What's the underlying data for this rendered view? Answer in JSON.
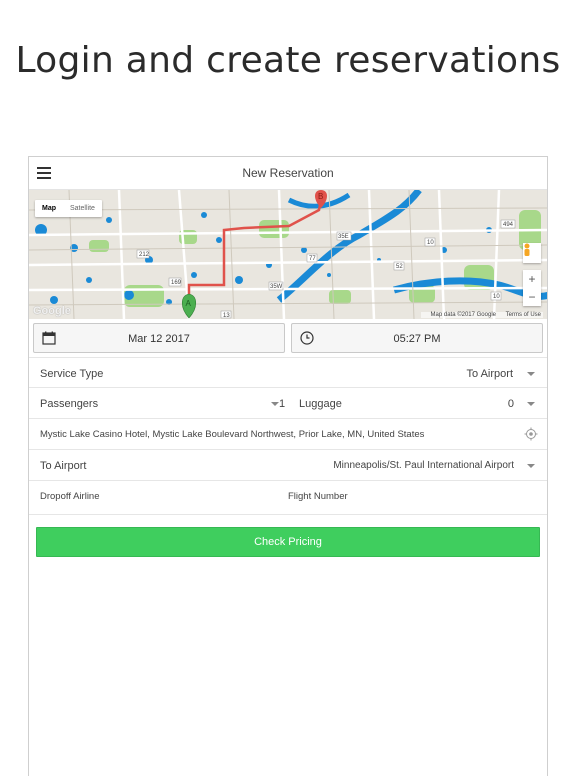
{
  "headline": "Login and create reservations",
  "navbar": {
    "title": "New Reservation"
  },
  "map": {
    "type_map": "Map",
    "type_satellite": "Satellite",
    "logo": "Google",
    "attribution": "Map data ©2017 Google",
    "terms": "Terms of Use",
    "zoom_in": "+",
    "zoom_out": "−",
    "marker_a": "A",
    "marker_b": "B",
    "road_shields": [
      "494",
      "212",
      "169",
      "35E",
      "35W",
      "77",
      "52",
      "10",
      "13",
      "10"
    ]
  },
  "datetime": {
    "date": "Mar 12 2017",
    "time": "05:27 PM"
  },
  "form": {
    "service_type_label": "Service Type",
    "service_type_value": "To Airport",
    "passengers_label": "Passengers",
    "passengers_value": "1",
    "luggage_label": "Luggage",
    "luggage_value": "0",
    "pickup_address": "Mystic Lake Casino Hotel, Mystic Lake Boulevard Northwest, Prior Lake, MN, United States",
    "to_airport_label": "To Airport",
    "to_airport_value": "Minneapolis/St. Paul International Airport",
    "dropoff_airline_placeholder": "Dropoff Airline",
    "flight_number_placeholder": "Flight Number"
  },
  "button": {
    "check_pricing": "Check Pricing"
  },
  "colors": {
    "accent_green": "#3fce5e",
    "route_red": "#e0524b",
    "marker_green": "#4caf50",
    "water_blue": "#1a8ad6",
    "park_green": "#7ed321"
  }
}
